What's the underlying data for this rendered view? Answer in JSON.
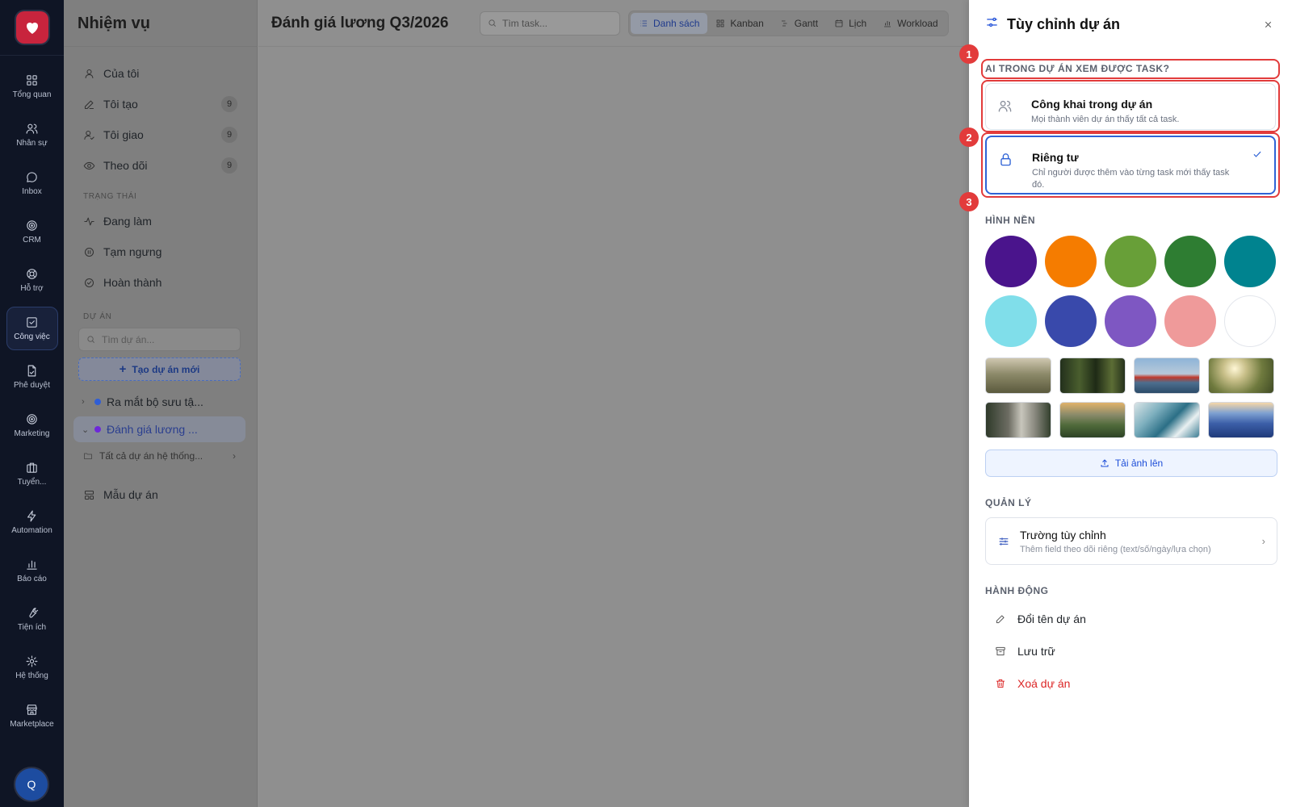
{
  "rail": {
    "items": [
      {
        "label": "Tổng quan",
        "icon": "grid-icon"
      },
      {
        "label": "Nhân sự",
        "icon": "users-icon"
      },
      {
        "label": "Inbox",
        "icon": "chat-icon"
      },
      {
        "label": "CRM",
        "icon": "target-icon"
      },
      {
        "label": "Hỗ trợ",
        "icon": "lifebuoy-icon"
      },
      {
        "label": "Công việc",
        "icon": "checkbox-icon"
      },
      {
        "label": "Phê duyệt",
        "icon": "document-icon"
      },
      {
        "label": "Marketing",
        "icon": "target-icon"
      },
      {
        "label": "Tuyển...",
        "icon": "briefcase-icon"
      },
      {
        "label": "Automation",
        "icon": "bolt-icon"
      },
      {
        "label": "Báo cáo",
        "icon": "bar-chart-icon"
      },
      {
        "label": "Tiện ích",
        "icon": "wrench-icon"
      },
      {
        "label": "Hệ thống",
        "icon": "gear-icon"
      },
      {
        "label": "Marketplace",
        "icon": "store-icon"
      }
    ],
    "avatar_initial": "Q"
  },
  "sidebar": {
    "title": "Nhiệm vụ",
    "items": [
      {
        "label": "Của tôi",
        "count": ""
      },
      {
        "label": "Tôi tạo",
        "count": "9"
      },
      {
        "label": "Tôi giao",
        "count": "9"
      },
      {
        "label": "Theo dõi",
        "count": "9"
      }
    ],
    "status_heading": "TRẠNG THÁI",
    "statuses": [
      {
        "label": "Đang làm"
      },
      {
        "label": "Tạm ngưng"
      },
      {
        "label": "Hoàn thành"
      }
    ],
    "project_heading": "DỰ ÁN",
    "project_search_placeholder": "Tìm dự án...",
    "new_project_label": "Tạo dự án mới",
    "projects": [
      {
        "label": "Ra mắt bộ sưu tậ...",
        "color": "#2f5ed6"
      },
      {
        "label": "Đánh giá lương ...",
        "color": "#6d28d9"
      }
    ],
    "all_projects_label": "Tất cả dự án hệ thống...",
    "templates_label": "Mẫu dự án"
  },
  "main": {
    "title": "Đánh giá lương Q3/2026",
    "search_placeholder": "Tìm task...",
    "views": [
      {
        "label": "Danh sách"
      },
      {
        "label": "Kanban"
      },
      {
        "label": "Gantt"
      },
      {
        "label": "Lịch"
      },
      {
        "label": "Workload"
      }
    ]
  },
  "panel": {
    "title": "Tùy chỉnh dự án",
    "visibility_heading": "AI TRONG DỰ ÁN XEM ĐƯỢC TASK?",
    "options": [
      {
        "title": "Công khai trong dự án",
        "desc": "Mọi thành viên dự án thấy tất cả task."
      },
      {
        "title": "Riêng tư",
        "desc": "Chỉ người được thêm vào từng task mới thấy task đó."
      }
    ],
    "background_heading": "HÌNH NỀN",
    "swatch_colors": [
      "#4a148c",
      "#f57c00",
      "#689f38",
      "#2e7d32",
      "#00838f",
      "#80deea",
      "#3949ab",
      "#7e57c2",
      "#ef9a9a",
      "#ffffff"
    ],
    "upload_label": "Tải ảnh lên",
    "manage_heading": "QUẢN LÝ",
    "custom_field_title": "Trường tùy chỉnh",
    "custom_field_desc": "Thêm field theo dõi riêng (text/số/ngày/lựa chọn)",
    "actions_heading": "HÀNH ĐỘNG",
    "actions": [
      {
        "label": "Đổi tên dự án"
      },
      {
        "label": "Lưu trữ"
      },
      {
        "label": "Xoá dự án"
      }
    ],
    "markers": [
      "1",
      "2",
      "3"
    ]
  }
}
